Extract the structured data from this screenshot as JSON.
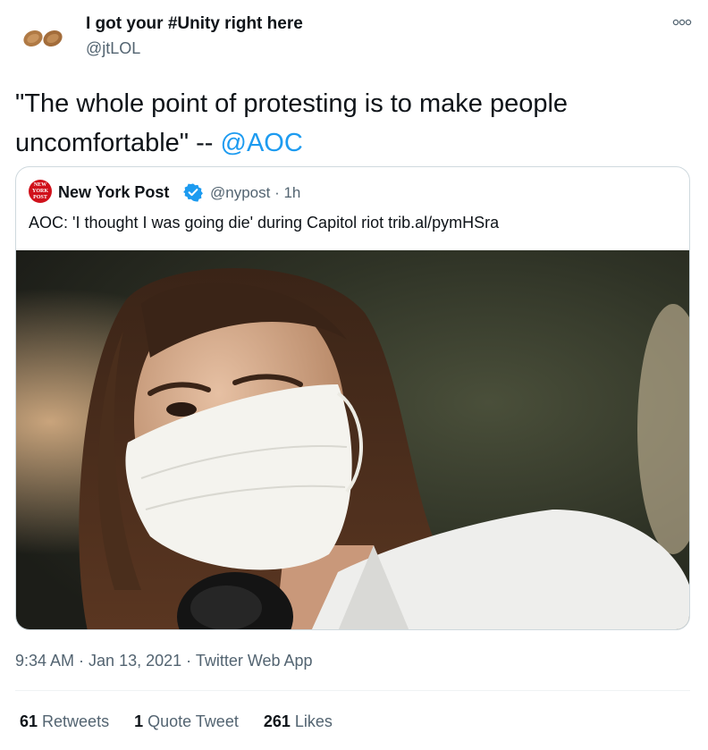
{
  "author": {
    "name": "I got your #Unity right here",
    "handle": "@jtLOL",
    "avatar_icon": "almonds-avatar-icon"
  },
  "tweet": {
    "text_before_mention": "\"The whole point of protesting is to make people uncomfortable\" -- ",
    "mention": "@AOC"
  },
  "quoted_tweet": {
    "name": "New York Post",
    "handle_time": "@nypost · 1h",
    "verified_icon": "verified-badge-icon",
    "avatar_text": [
      "NEW",
      "YORK",
      "POST"
    ],
    "text": "AOC: 'I thought I was going die' during Capitol riot trib.al/pymHSra",
    "image_icon": "photo-woman-in-face-mask"
  },
  "meta": {
    "time": "9:34 AM",
    "separator1": " · ",
    "date": "Jan 13, 2021",
    "separator2": " · ",
    "app": "Twitter Web App"
  },
  "stats": {
    "retweets_count": "61",
    "retweets_label": "Retweets",
    "quotes_count": "1",
    "quotes_label": "Quote Tweet",
    "likes_count": "261",
    "likes_label": "Likes"
  },
  "colors": {
    "accent": "#1d9bf0",
    "secondary_text": "#536471",
    "primary_text": "#0f1419",
    "nypost_red": "#d0111b"
  }
}
